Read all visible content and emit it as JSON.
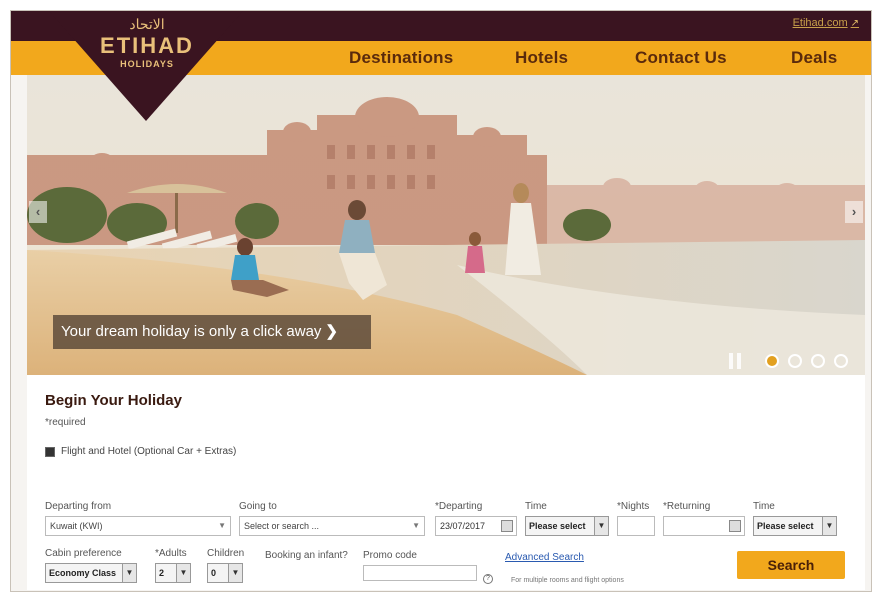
{
  "header": {
    "external_link": "Etihad.com",
    "brand_arabic": "الاتحاد",
    "brand_name": "ETIHAD",
    "brand_sub": "HOLIDAYS"
  },
  "nav": {
    "items": [
      "Destinations",
      "Hotels",
      "Contact Us",
      "Deals"
    ]
  },
  "hero": {
    "promo_text": "Your dream holiday is only a click away",
    "prev_label": "‹",
    "next_label": "›",
    "slides_total": 4,
    "slide_active": 1
  },
  "form": {
    "title": "Begin Your Holiday",
    "required_note": "*required",
    "package_option": "Flight and Hotel (Optional Car + Extras)",
    "departing_from_label": "Departing from",
    "departing_from_value": "Kuwait (KWI)",
    "going_to_label": "Going to",
    "going_to_placeholder": "Select or search ...",
    "departing_label": "*Departing",
    "departing_value": "23/07/2017",
    "time1_label": "Time",
    "time1_value": "Please select",
    "nights_label": "*Nights",
    "nights_value": "",
    "returning_label": "*Returning",
    "returning_value": "",
    "time2_label": "Time",
    "time2_value": "Please select",
    "cabin_label": "Cabin preference",
    "cabin_value": "Economy Class",
    "adults_label": "*Adults",
    "adults_value": "2",
    "children_label": "Children",
    "children_value": "0",
    "infant_label": "Booking an infant?",
    "promo_label": "Promo code",
    "promo_value": "",
    "advanced_search": "Advanced Search",
    "advanced_hint": "For multiple rooms and flight options",
    "search_button": "Search"
  },
  "colors": {
    "accent": "#f2a81c",
    "topbar": "#3a1420",
    "logo": "#3a1420"
  }
}
